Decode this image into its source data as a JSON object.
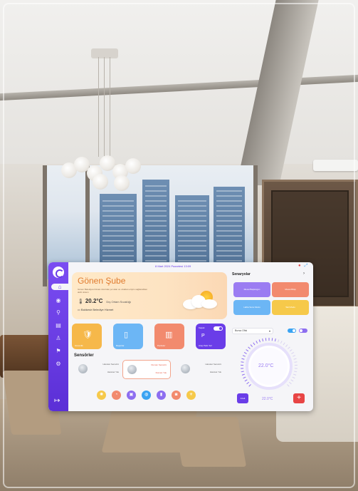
{
  "topbar": {
    "datetime": "8 Mart 2024 Pazartesi 13:09",
    "icons": [
      "notification-icon",
      "expand-icon"
    ]
  },
  "sidebar": {
    "items": [
      {
        "icon": "home-icon",
        "glyph": "⌂"
      },
      {
        "icon": "camera-icon",
        "glyph": "◉"
      },
      {
        "icon": "location-icon",
        "glyph": "⚲"
      },
      {
        "icon": "calendar-icon",
        "glyph": "▤"
      },
      {
        "icon": "users-icon",
        "glyph": "♙"
      },
      {
        "icon": "flag-icon",
        "glyph": "⚑"
      },
      {
        "icon": "settings-icon",
        "glyph": "⚙"
      }
    ],
    "logout_glyph": "↦"
  },
  "weather": {
    "branch": "Gönen Şube",
    "subtitle": "Gönen Belediyesi binası üzerinde yer alan ve uzaktan erişim sağlanabilen akıllı sistem",
    "temperature": "20.2°C",
    "temperature_label": "Dış Ortam Sıcaklığı",
    "location": "Balıkesir Belediye Hizmet",
    "icon": "partly-cloudy-icon"
  },
  "tiles": [
    {
      "icon": "shield-icon",
      "glyph": "🛡",
      "label": "Güvenlik",
      "color": "#f6b84a"
    },
    {
      "icon": "document-icon",
      "glyph": "▯",
      "label": "Raporlar",
      "color": "#6cb6f5"
    },
    {
      "icon": "curtain-icon",
      "glyph": "▥",
      "label": "Perdeler",
      "color": "#f28a6e"
    },
    {
      "icon": "parking-icon",
      "glyph": "P",
      "label": "Araç Park Yeri",
      "toggle_label": "Kapalı",
      "color": "#6a3de8"
    }
  ],
  "sensors": {
    "title": "Sensörler",
    "items": [
      {
        "name": "Hareket Sensörü",
        "state": "Hareket Yok"
      },
      {
        "name": "Duman Sensörü",
        "state": "Duman Yok"
      },
      {
        "name": "Hareket Sensörü",
        "state": "Hareket Yok"
      }
    ]
  },
  "bottom_icons": [
    {
      "icon": "lightbulb-icon",
      "glyph": "✺",
      "color": "#f6c94a"
    },
    {
      "icon": "alarm-icon",
      "glyph": "◔",
      "color": "#f28a6e"
    },
    {
      "icon": "lock-icon",
      "glyph": "▣",
      "color": "#8d6ef0"
    },
    {
      "icon": "water-icon",
      "glyph": "◍",
      "color": "#3aa3f2"
    },
    {
      "icon": "door-icon",
      "glyph": "▮",
      "color": "#8d6ef0"
    },
    {
      "icon": "camera-icon",
      "glyph": "◙",
      "color": "#f28a6e"
    },
    {
      "icon": "sun-icon",
      "glyph": "☀",
      "color": "#f6c94a"
    }
  ],
  "scenarios": {
    "title": "Senaryolar",
    "items": [
      {
        "label": "Mesai Başlangıcı",
        "color": "#9b7cf2"
      },
      {
        "label": "Mesai Bitişi",
        "color": "#f28a6e"
      },
      {
        "label": "Hafta Sonu Modu",
        "color": "#6cb6f5"
      },
      {
        "label": "Tatil Modu",
        "color": "#f6c94a"
      }
    ]
  },
  "thermostat": {
    "room": "Bursa Ofisi",
    "set_temperature": "22.0°C",
    "room_temperature": "22.0°C",
    "minus_label": "Azalt",
    "plus_label": "+",
    "setpoint_fraction": 0.55
  }
}
